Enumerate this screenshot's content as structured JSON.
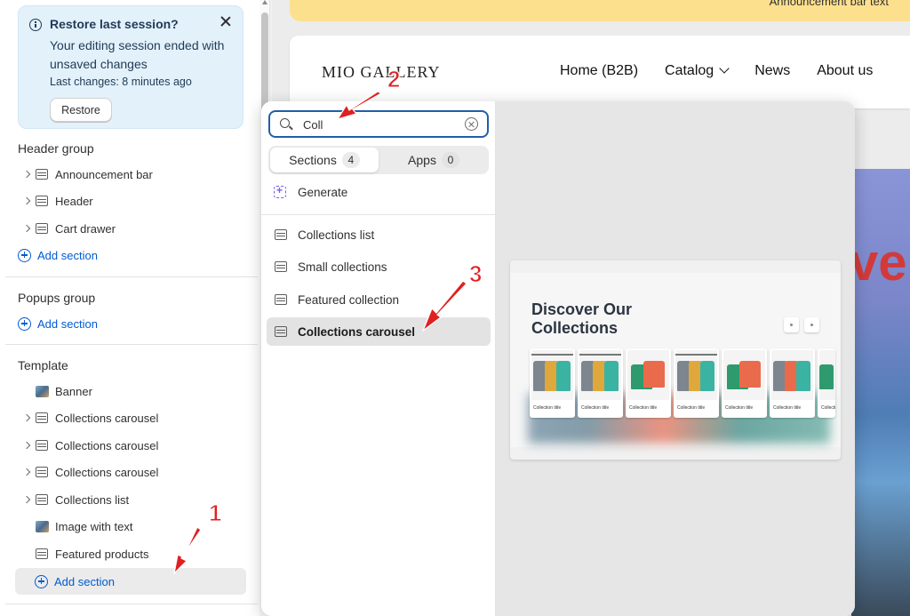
{
  "restore_banner": {
    "title": "Restore last session?",
    "body": "Your editing session ended with unsaved changes",
    "last_changes": "Last changes: 8 minutes ago",
    "restore_label": "Restore"
  },
  "sidebar": {
    "header_group": {
      "title": "Header group",
      "items": [
        "Announcement bar",
        "Header",
        "Cart drawer"
      ],
      "add_label": "Add section"
    },
    "popups_group": {
      "title": "Popups group",
      "add_label": "Add section"
    },
    "template": {
      "title": "Template",
      "items": [
        "Banner",
        "Collections carousel",
        "Collections carousel",
        "Collections carousel",
        "Collections list",
        "Image with text",
        "Featured products"
      ],
      "add_label": "Add section"
    }
  },
  "preview": {
    "announcement_text": "Announcement bar text",
    "logo": "MIO GALLERY",
    "nav": [
      "Home (B2B)",
      "Catalog",
      "News",
      "About us"
    ],
    "hero_text": "ve"
  },
  "picker": {
    "search_value": "Coll",
    "tabs": [
      {
        "label": "Sections",
        "count": "4"
      },
      {
        "label": "Apps",
        "count": "0"
      }
    ],
    "generate_label": "Generate",
    "results": [
      "Collections list",
      "Small collections",
      "Featured collection",
      "Collections carousel"
    ],
    "selected_index": 3,
    "preview_card": {
      "title": "Discover Our Collections",
      "tile_caption": "Collection title"
    }
  },
  "annotations": [
    "1",
    "2",
    "3"
  ],
  "colors": {
    "accent_blue": "#005bd3",
    "annotation_red": "#e02020",
    "announcement_bar": "#fde08d"
  }
}
